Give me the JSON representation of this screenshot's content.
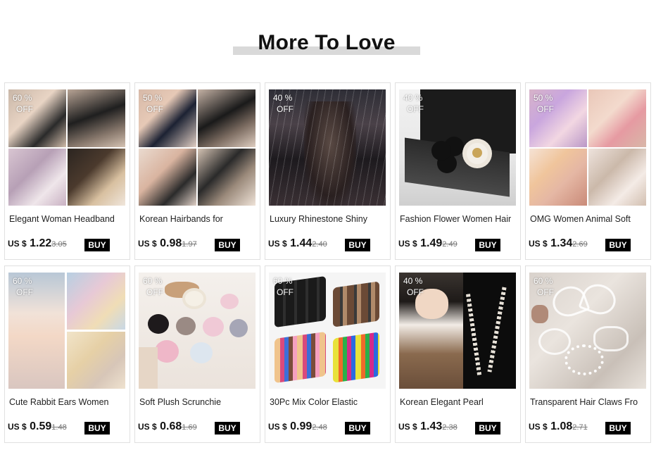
{
  "section": {
    "title": "More To Love"
  },
  "products": [
    {
      "discount": "60 %",
      "off": "OFF",
      "name": "Elegant Woman Headband",
      "currency": "US $",
      "price": "1.22",
      "old_price": "3.05",
      "buy": "BUY"
    },
    {
      "discount": "50 %",
      "off": "OFF",
      "name": "Korean Hairbands for",
      "currency": "US $",
      "price": "0.98",
      "old_price": "1.97",
      "buy": "BUY"
    },
    {
      "discount": "40 %",
      "off": "OFF",
      "name": "Luxury Rhinestone Shiny",
      "currency": "US $",
      "price": "1.44",
      "old_price": "2.40",
      "buy": "BUY"
    },
    {
      "discount": "40 %",
      "off": "OFF",
      "name": "Fashion Flower Women Hair",
      "currency": "US $",
      "price": "1.49",
      "old_price": "2.49",
      "buy": "BUY"
    },
    {
      "discount": "50 %",
      "off": "OFF",
      "name": "OMG Women Animal Soft",
      "currency": "US $",
      "price": "1.34",
      "old_price": "2.69",
      "buy": "BUY"
    },
    {
      "discount": "60 %",
      "off": "OFF",
      "name": "Cute Rabbit Ears Women",
      "currency": "US $",
      "price": "0.59",
      "old_price": "1.48",
      "buy": "BUY"
    },
    {
      "discount": "60 %",
      "off": "OFF",
      "name": "Soft Plush Scrunchie",
      "currency": "US $",
      "price": "0.68",
      "old_price": "1.69",
      "buy": "BUY"
    },
    {
      "discount": "60 %",
      "off": "OFF",
      "name": "30Pc Mix Color Elastic",
      "currency": "US $",
      "price": "0.99",
      "old_price": "2.48",
      "buy": "BUY"
    },
    {
      "discount": "40 %",
      "off": "OFF",
      "name": "Korean Elegant Pearl",
      "currency": "US $",
      "price": "1.43",
      "old_price": "2.38",
      "buy": "BUY"
    },
    {
      "discount": "60 %",
      "off": "OFF",
      "name": "Transparent Hair Claws Fro",
      "currency": "US $",
      "price": "1.08",
      "old_price": "2.71",
      "buy": "BUY"
    }
  ]
}
